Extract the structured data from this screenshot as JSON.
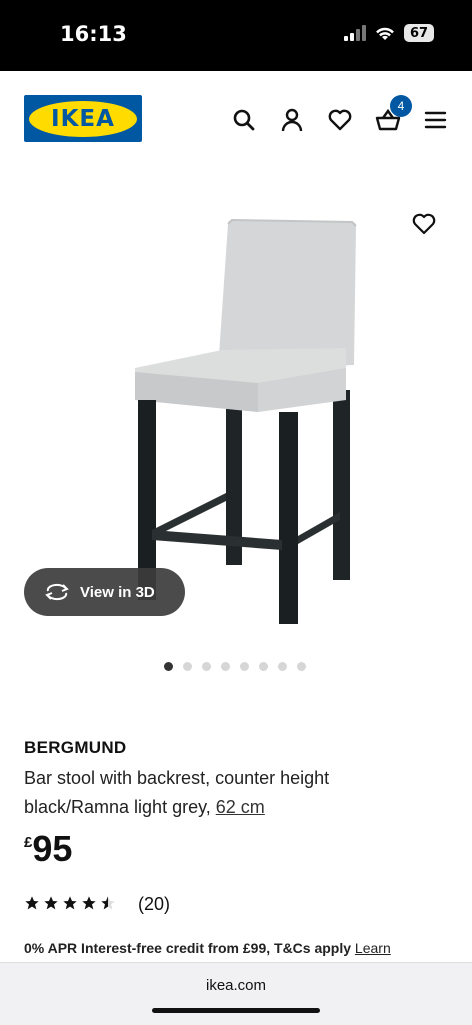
{
  "status_bar": {
    "time": "16:13",
    "battery": "67"
  },
  "header": {
    "logo_text": "IKEA",
    "basket_count": "4"
  },
  "gallery": {
    "view_3d_label": "View in 3D",
    "total_images": 8,
    "active_index": 0
  },
  "product": {
    "name": "BERGMUND",
    "description_line1": "Bar stool with backrest, counter height",
    "description_line2": "black/Ramna light grey,",
    "size": "62 cm",
    "price_currency": "£",
    "price_value": "95",
    "rating": 4.5,
    "review_count": "(20)"
  },
  "credit": {
    "text": "0% APR Interest-free credit from £99, T&Cs apply ",
    "link": "Learn"
  },
  "browser": {
    "url": "ikea.com"
  },
  "colors": {
    "ikea_blue": "#0058a3",
    "ikea_yellow": "#ffdb00"
  }
}
